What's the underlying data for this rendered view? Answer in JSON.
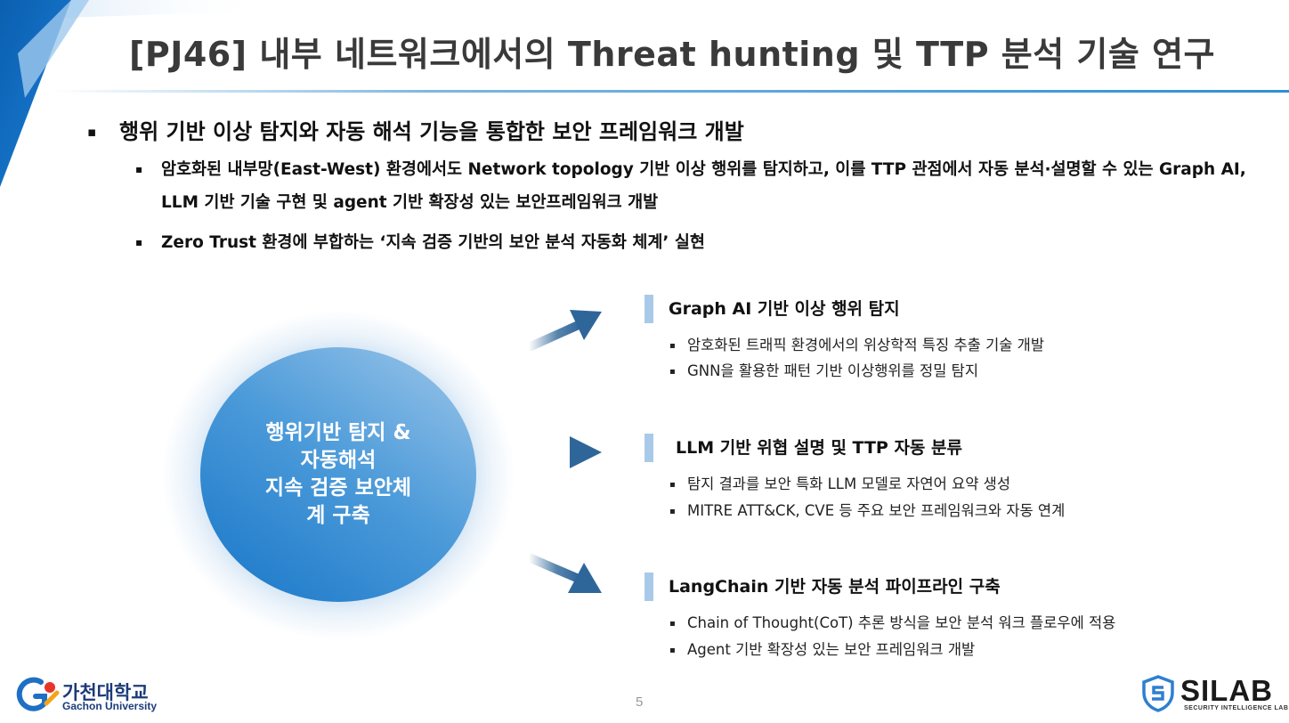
{
  "title": "[PJ46] 내부 네트워크에서의 Threat hunting 및 TTP 분석 기술 연구",
  "bullet_marker": "▪",
  "main_bullet": "행위 기반 이상 탐지와 자동 해석 기능을 통합한 보안 프레임워크 개발",
  "sub_bullets": [
    "암호화된 내부망(East-West) 환경에서도 Network topology 기반 이상 행위를 탐지하고, 이를 TTP 관점에서 자동 분석·설명할 수 있는 Graph AI, LLM 기반 기술 구현 및 agent 기반 확장성 있는 보안프레임워크 개발",
    "Zero Trust 환경에 부합하는 ‘지속 검증 기반의 보안 분석 자동화 체계’ 실현"
  ],
  "center_circle": {
    "lines": [
      "행위기반 탐지 &",
      "자동해석",
      "지속 검증 보안체",
      "계 구축"
    ]
  },
  "sections": [
    {
      "title": "Graph AI 기반 이상 행위 탐지",
      "items": [
        "암호화된 트래픽 환경에서의 위상학적 특징 추출 기술 개발",
        "GNN을 활용한 패턴 기반 이상행위를 정밀 탐지"
      ]
    },
    {
      "title": "LLM 기반 위협 설명 및 TTP 자동 분류",
      "items": [
        "탐지 결과를 보안 특화 LLM 모델로 자연어 요약 생성",
        "MITRE ATT&CK, CVE 등 주요 보안 프레임워크와 자동 연계"
      ]
    },
    {
      "title": "LangChain 기반 자동 분석 파이프라인 구축",
      "items": [
        "Chain of Thought(CoT) 추론 방식을 보안 분석 워크 플로우에 적용",
        "Agent 기반 확장성 있는 보안 프레임워크 개발"
      ]
    }
  ],
  "page_number": "5",
  "footer": {
    "university_name": "가천대학교",
    "university_sub": "Gachon University",
    "lab_name": "SILAB",
    "lab_sub": "SECURITY INTELLIGENCE LAB"
  },
  "colors": {
    "accent_blue": "#1876c8",
    "light_blue": "#a9c9e8",
    "arrow": "#3b6f9e"
  }
}
